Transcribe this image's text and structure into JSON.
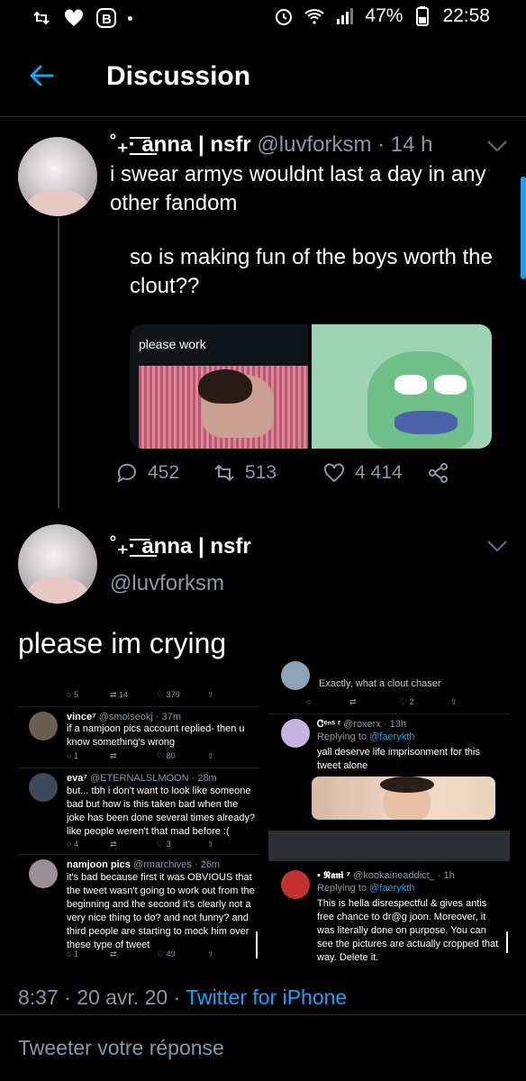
{
  "status_bar": {
    "battery": "47%",
    "time": "22:58"
  },
  "header": {
    "title": "Discussion"
  },
  "tweet1": {
    "name": "˚₊·͟͟͞͞ ͟anna | nsfr",
    "handle": "@luvforksm",
    "time": "14 h",
    "text_line1": "i swear armys wouldnt last a day in any other fandom",
    "text_quote": "so is making fun of the boys worth the clout??",
    "media_caption": "please work",
    "replies": "452",
    "retweets": "513",
    "likes": "4 414"
  },
  "tweet2": {
    "name": "˚₊·͟͟͞͞ ͟anna | nsfr",
    "handle": "@luvforksm",
    "text": "please im crying",
    "timestamp": "8:37 · 20 avr. 20 · ",
    "source": "Twitter for iPhone"
  },
  "embedded": {
    "left_top_actions": [
      "5",
      "14",
      "379"
    ],
    "vince_name": "vince⁷",
    "vince_handle": "@smolseokj · 37m",
    "vince_text": "if a namjoon pics account replied- then u know something's wrong",
    "vince_actions": [
      "1",
      "",
      "80"
    ],
    "eva_name": "eva⁷",
    "eva_handle": "@ETERNALSLMOON · 28m",
    "eva_text": "but... tbh i don't want to look like someone bad but how is this taken bad when the joke has been done several times already? like people weren't that mad before :(",
    "eva_actions": [
      "4",
      "",
      "3"
    ],
    "namjoon_name": "namjoon pics",
    "namjoon_handle": "@rmarchives · 26m",
    "namjoon_text": "it's bad because first it was OBVIOUS that the tweet wasn't going to work out from the beginning and the second it's clearly not a very nice thing to do? and not funny? and third people are starting to mock him over these type of tweet",
    "namjoon_actions": [
      "1",
      "",
      "49"
    ],
    "right_top_text": "Exactly, what a clout chaser",
    "right_top_actions": [
      "",
      "",
      "2"
    ],
    "roxerx_name": "Ꮳᵉⁿˢ ʳ",
    "roxerx_handle": "@roxerx · 13h",
    "roxerx_reply_prefix": "Replying to ",
    "roxerx_reply_to": "@faerykth",
    "roxerx_text": "yall deserve life imprisonment for this tweet alone",
    "nani_name": "• 𝕹𝖆𝖓𝖎 ⁷",
    "nani_handle": "@kookaineaddict_ · 1h",
    "nani_reply_prefix": "Replying to ",
    "nani_reply_to": "@faerykth",
    "nani_text": "This is hella disrespectful & gives antis free chance to dr@g joon. Moreover, it was literally done on purpose. You can see the pictures are actually cropped that way. Delete it."
  },
  "reply_placeholder": "Tweeter votre réponse",
  "colors": {
    "accent": "#1da1f2",
    "secondary_text": "#8899a6",
    "background": "#000000",
    "divider": "#2f3336"
  }
}
